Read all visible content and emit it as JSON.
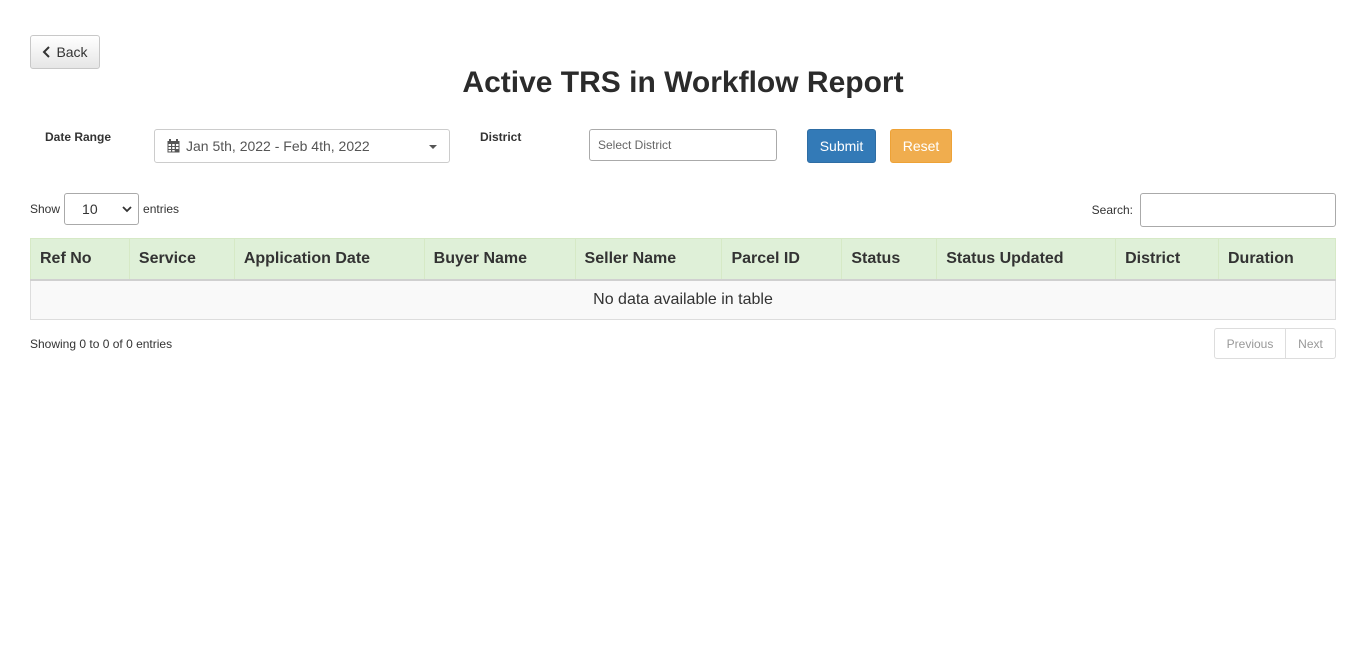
{
  "header": {
    "back_label": "Back",
    "title": "Active TRS in Workflow Report"
  },
  "filters": {
    "date_range_label": "Date Range",
    "date_range_value": "Jan 5th, 2022 - Feb 4th, 2022",
    "district_label": "District",
    "district_placeholder": "Select District",
    "submit_label": "Submit",
    "reset_label": "Reset"
  },
  "table_controls": {
    "show_label": "Show",
    "page_length": "10",
    "entries_label": "entries",
    "search_label": "Search:",
    "search_value": ""
  },
  "table": {
    "columns": [
      "Ref No",
      "Service",
      "Application Date",
      "Buyer Name",
      "Seller Name",
      "Parcel ID",
      "Status",
      "Status Updated",
      "District",
      "Duration"
    ],
    "empty_message": "No data available in table"
  },
  "footer": {
    "info": "Showing 0 to 0 of 0 entries",
    "previous_label": "Previous",
    "next_label": "Next"
  },
  "colors": {
    "primary": "#337ab7",
    "warning": "#f0ad4e",
    "header_bg": "#dff0d8"
  },
  "icons": {
    "back": "chevron-left-icon",
    "date": "calendar-icon",
    "date_dropdown": "caret-down-icon",
    "length_dropdown": "chevron-down-icon"
  }
}
